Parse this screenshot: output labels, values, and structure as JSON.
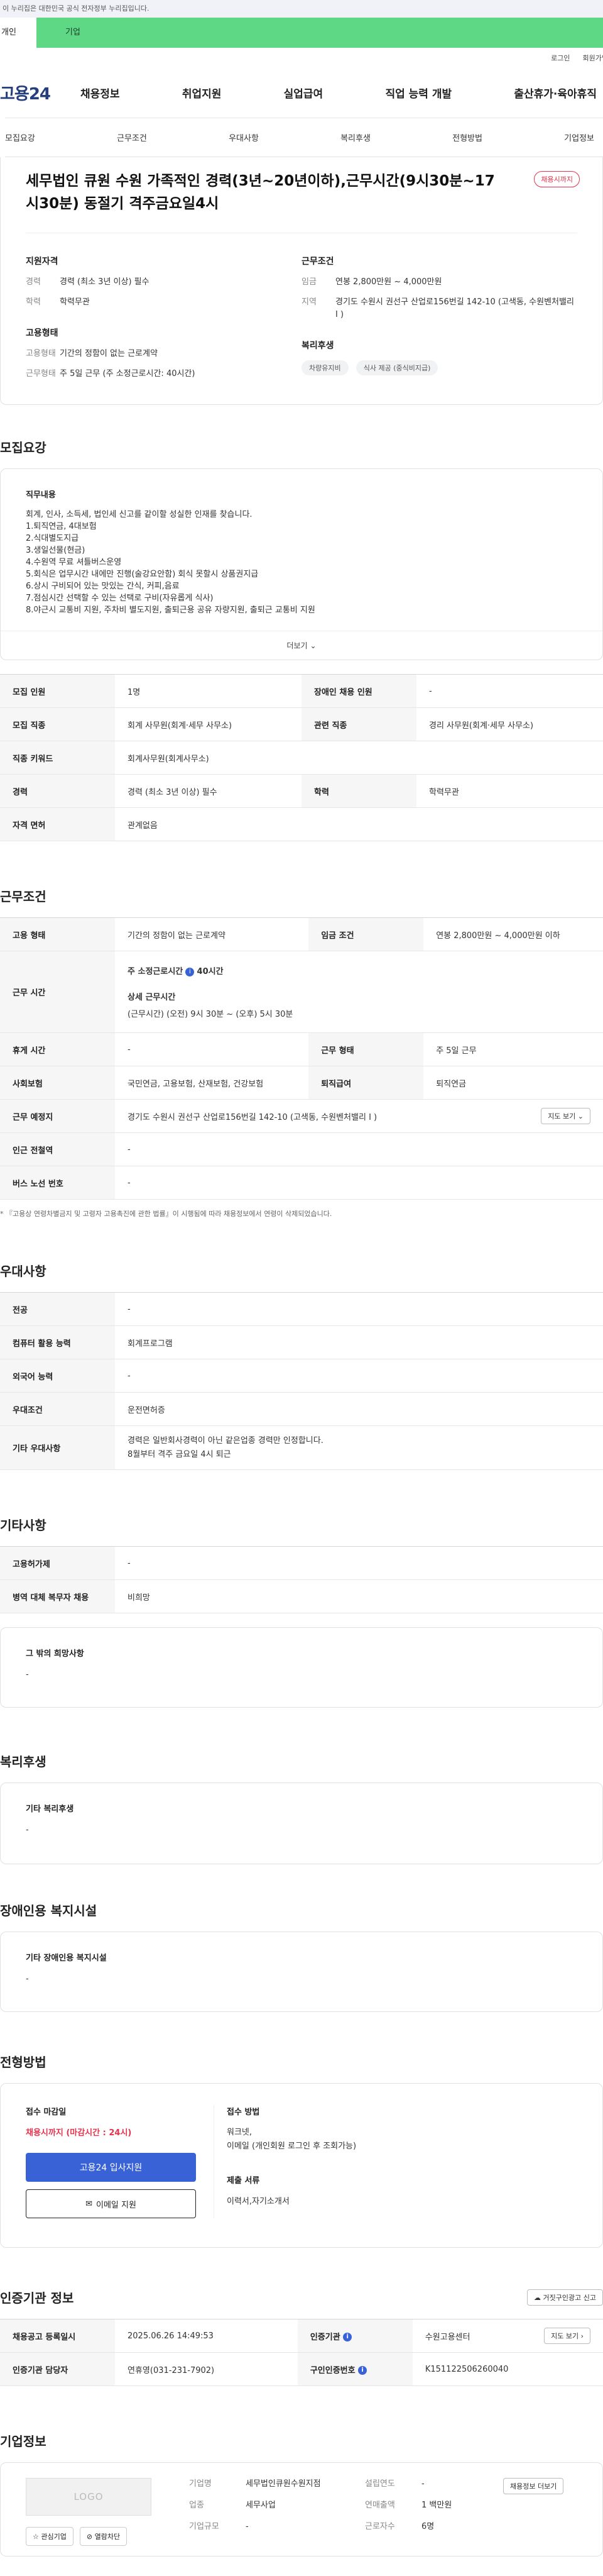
{
  "top_notice": "이 누리집은 대한민국 공식 전자정부 누리집입니다.",
  "site_tabs": [
    "개인",
    "기업"
  ],
  "util_links": [
    "로그인",
    "회원가입"
  ],
  "logo": "고용24",
  "gnb": [
    "채용정보",
    "취업지원",
    "실업급여",
    "직업 능력 개발",
    "출산휴가·육아휴직"
  ],
  "subnav": [
    "모집요강",
    "근무조건",
    "우대사항",
    "복리후생",
    "전형방법",
    "기업정보"
  ],
  "job": {
    "title": "세무법인 큐원 수원 가족적인 경력(3년~20년이하),근무시간(9시30분~17시30분) 동절기 격주금요일4시",
    "badge": "채용시까지",
    "qual_h": "지원자격",
    "qual": [
      {
        "k": "경력",
        "v": "경력 (최소 3년 이상) 필수"
      },
      {
        "k": "학력",
        "v": "학력무관"
      }
    ],
    "emp_h": "고용형태",
    "emp": [
      {
        "k": "고용형태",
        "v": "기간의 정함이 없는 근로계약"
      },
      {
        "k": "근무형태",
        "v": "주 5일 근무 (주 소정근로시간: 40시간)"
      }
    ],
    "cond_h": "근무조건",
    "cond": [
      {
        "k": "임금",
        "v": "연봉 2,800만원 ~ 4,000만원"
      },
      {
        "k": "지역",
        "v": "경기도 수원시 권선구 산업로156번길 142-10 (고색동, 수원벤처밸리 I )"
      }
    ],
    "welfare_h": "복리후생",
    "welfare_chips": [
      "차량유지비",
      "식사 제공 (중식비지급)"
    ]
  },
  "recruit": {
    "title": "모집요강",
    "duty_h": "직무내용",
    "duty_text": "회계, 인사, 소득세, 법인세 신고를 같이할 성실한 인재를 찾습니다.\n1.퇴직연금, 4대보험\n2.식대별도지급\n3.생일선물(현금)\n4.수원역 무료 셔틀버스운영\n5.회식은 업무시간 내에만 진행(술강요안함) 회식 못할시 상품권지급\n6.상시 구비되어 있는 맛있는 간식, 커피,음료\n7.점심시간 선택할 수 있는 선택로 구비(자유롭게 식사)\n8.야근시 교통비 지원, 주차비 별도지원, 출퇴근용 공유 자량지원, 출퇴근 교통비 지원",
    "more": "더보기",
    "rows": [
      [
        "모집 인원",
        "1명",
        "장애인 채용 인원",
        "-"
      ],
      [
        "모집 직종",
        "회계 사무원(회계·세무 사무소)",
        "관련 직종",
        "경리 사무원(회계·세무 사무소)"
      ],
      [
        "직종 키워드",
        "회계사무원(회계사무소)",
        "",
        ""
      ],
      [
        "경력",
        "경력 (최소 3년 이상) 필수",
        "학력",
        "학력무관"
      ],
      [
        "자격 면허",
        "관계없음",
        "",
        ""
      ]
    ]
  },
  "conditions": {
    "title": "근무조건",
    "emp_type_k": "고용 형태",
    "emp_type_v": "기간의 정함이 없는 근로계약",
    "wage_k": "임금 조건",
    "wage_v": "연봉 2,800만원 ~ 4,000만원 이하",
    "hours_k": "근무 시간",
    "hours_week_label": "주 소정근로시간",
    "hours_week_value": "40시간",
    "hours_detail_label": "상세 근무시간",
    "hours_detail": "(근무시간) (오전) 9시 30분 ~ (오후) 5시 30분",
    "rest_k": "휴게 시간",
    "rest_v": "-",
    "work_form_k": "근무 형태",
    "work_form_v": "주 5일 근무",
    "insurance_k": "사회보험",
    "insurance_v": "국민연금, 고용보험, 산재보험, 건강보험",
    "retire_k": "퇴직급여",
    "retire_v": "퇴직연금",
    "place_k": "근무 예정지",
    "place_v": "경기도 수원시 권선구 산업로156번길 142-10 (고색동, 수원벤처밸리 I )",
    "map_btn": "지도 보기",
    "subway_k": "인근 전철역",
    "subway_v": "-",
    "bus_k": "버스 노선 번호",
    "bus_v": "-",
    "note": "* 『고용상 연령차별금지 및 고령자 고용촉진에 관한 법률』이 시행됨에 따라 채용정보에서 연령이 삭제되었습니다."
  },
  "preference": {
    "title": "우대사항",
    "rows": [
      [
        "전공",
        "-"
      ],
      [
        "컴퓨터 활용 능력",
        "회계프로그램"
      ],
      [
        "외국어 능력",
        "-"
      ],
      [
        "우대조건",
        "운전면허증"
      ],
      [
        "기타 우대사항",
        "경력은 일반회사경력이 아닌 같은업종 경력만 인정합니다.\n8월부터 격주 금요일 4시 퇴근"
      ]
    ]
  },
  "etc": {
    "title": "기타사항",
    "rows": [
      [
        "고용허가제",
        "-"
      ],
      [
        "병역 대체 복무자 채용",
        "비희망"
      ]
    ],
    "hope_h": "그 밖의 희망사항",
    "hope_v": "-"
  },
  "welfare": {
    "title": "복리후생",
    "h": "기타 복리후생",
    "v": "-"
  },
  "disability": {
    "title": "장애인용 복지시설",
    "h": "기타 장애인용 복지시설",
    "v": "-"
  },
  "apply": {
    "title": "전형방법",
    "deadline_h": "접수 마감일",
    "deadline_v": "채용시까지 (마감시간 : 24시)",
    "btn_apply": "고용24 입사지원",
    "btn_email": "이메일 지원",
    "method_h": "접수 방법",
    "method_v1": "워크넷,",
    "method_v2": "이메일 (개인회원 로그인 후 조회가능)",
    "docs_h": "제출 서류",
    "docs_v": "이력서,자기소개서"
  },
  "cert": {
    "title": "인증기관 정보",
    "btn": "거짓구인광고 신고",
    "reg_k": "채용공고 등록일시",
    "reg_v": "2025.06.26 14:49:53",
    "org_k": "인증기관",
    "org_v": "수원고용센터",
    "map_btn": "지도 보기",
    "staff_k": "인증기관 담당자",
    "staff_v": "연휴영(031-231-7902)",
    "num_k": "구인인증번호",
    "num_v": "K151122506260040"
  },
  "company": {
    "title": "기업정보",
    "logo": "LOGO",
    "btn_fav": "관심기업",
    "btn_block": "열람차단",
    "btn_jobs": "채용정보 더보기",
    "rows": [
      [
        "기업명",
        "세무법인큐원수원지점",
        "설립연도",
        "-"
      ],
      [
        "업종",
        "세무사업",
        "연매출액",
        "1 백만원"
      ],
      [
        "기업규모",
        "-",
        "근로자수",
        "6명"
      ]
    ]
  }
}
